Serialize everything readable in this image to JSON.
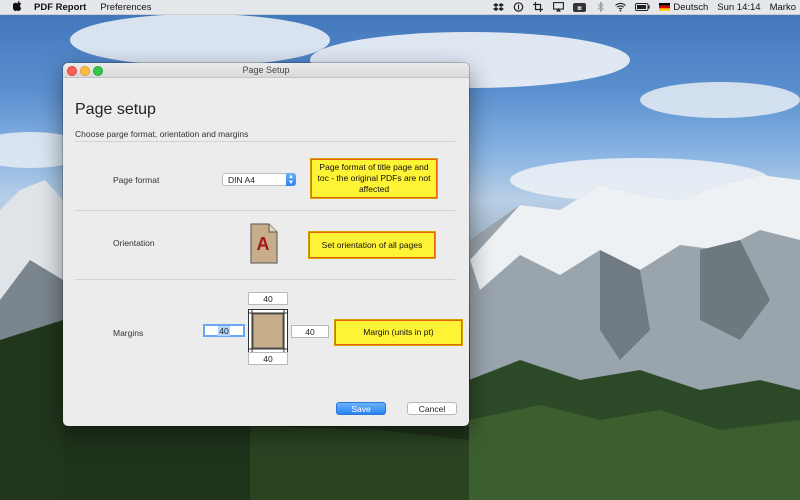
{
  "menubar": {
    "app_name": "PDF Report",
    "menu_preferences": "Preferences",
    "input_language": "Deutsch",
    "clock": "Sun 14:14",
    "user": "Marko"
  },
  "window": {
    "title": "Page Setup",
    "heading": "Page setup",
    "subheading": "Choose parge format, orientation and margins"
  },
  "page_format": {
    "label": "Page format",
    "selected": "DIN A4",
    "note": "Page format of title page and toc - the original PDFs are not affected"
  },
  "orientation": {
    "label": "Orientation",
    "icon_letter": "A",
    "note": "Set orientation of all pages"
  },
  "margins": {
    "label": "Margins",
    "top": "40",
    "left": "40",
    "right": "40",
    "bottom": "40",
    "note": "Margin (units in pt)"
  },
  "buttons": {
    "save": "Save",
    "cancel": "Cancel"
  },
  "colors": {
    "note_bg": "#fff335",
    "note_border": "#e8650f",
    "accent": "#2a82f4",
    "page_fill": "#c8ad8b",
    "icon_letter": "#a5141b"
  }
}
